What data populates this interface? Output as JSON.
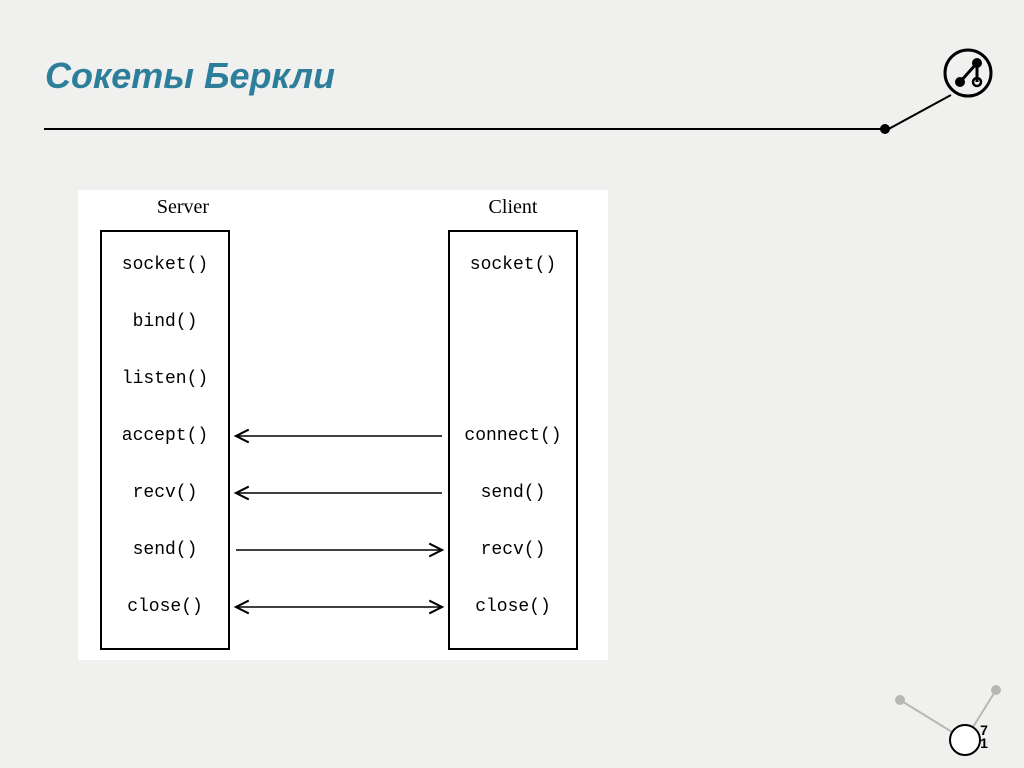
{
  "title": "Сокеты Беркли",
  "page_number_top": "7",
  "page_number_bottom": "1",
  "diagram": {
    "server_header": "Server",
    "client_header": "Client",
    "server_calls": [
      "socket()",
      "bind()",
      "listen()",
      "accept()",
      "recv()",
      "send()",
      "close()"
    ],
    "client_calls": [
      "socket()",
      "",
      "",
      "connect()",
      "send()",
      "recv()",
      "close()"
    ],
    "arrows": [
      {
        "row": 3,
        "from": "client",
        "to": "server",
        "bidir": false
      },
      {
        "row": 4,
        "from": "client",
        "to": "server",
        "bidir": false
      },
      {
        "row": 5,
        "from": "server",
        "to": "client",
        "bidir": false
      },
      {
        "row": 6,
        "from": "server",
        "to": "client",
        "bidir": true
      }
    ]
  }
}
